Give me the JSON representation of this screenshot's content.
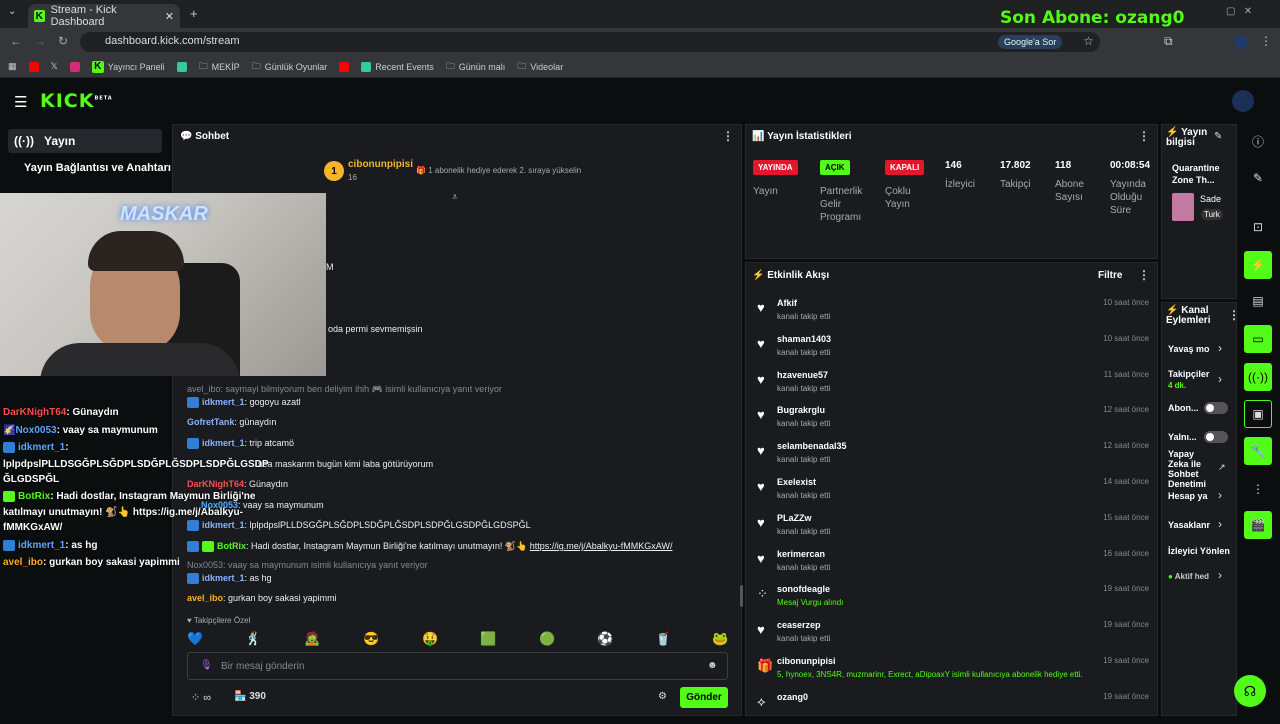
{
  "browser": {
    "tab_title": "Stream - Kick Dashboard",
    "url": "dashboard.kick.com/stream",
    "google_btn": "Google'a Sor",
    "bookmarks": [
      "Yayıncı Paneli",
      "MEKİP",
      "Günlük Oyunlar",
      "Recent Events",
      "Günün malı",
      "Videolar"
    ]
  },
  "overlay_top": "Son Abone: ozang0",
  "brand": {
    "logo": "KICK",
    "beta": "BETA"
  },
  "sidebar": {
    "items": [
      "Yayın",
      "Yayın Bağlantısı ve Anahtarı"
    ]
  },
  "webcam": {
    "label": "MASKAR"
  },
  "overlay_chat": [
    {
      "user": "DarKNighT64",
      "text": ": Günaydın"
    },
    {
      "user": "Nox0053",
      "text": ": vaay sa maymunum"
    },
    {
      "user": "idkmert_1",
      "text": ":"
    },
    {
      "user": "",
      "text": "lplpdpslPLLDSGĞPLSĞDPLSDĞPLĞSDPLSDPĞLGSDP"
    },
    {
      "user": "",
      "text": "ĞLGDSPĞL"
    },
    {
      "user": "BotRix",
      "text": ": Hadi dostlar, Instagram Maymun Birliği'ne"
    },
    {
      "user": "",
      "text": "katılmayı unutmayın! 🐒👆 https://ig.me/j/Abalkyu-"
    },
    {
      "user": "",
      "text": "fMMKGxAW/"
    },
    {
      "user": "idkmert_1",
      "text": ": as hg"
    },
    {
      "user": "avel_ibo",
      "text": ": gurkan boy sakasi yapimmi"
    }
  ],
  "chat": {
    "title": "Sohbet",
    "gifter": "cibonunpipisi",
    "gifter_count": "16",
    "gift_hint": "1 abonelik hediye ederek 2. sıraya yükselin",
    "partial1": "M",
    "partial2": "oda permi sevmemişsin",
    "messages": [
      {
        "reply": "avel_ibo: saymayi bilmiyorum ben deliyim ihih 🎮 isimli kullanıcıya yanıt veriyor"
      },
      {
        "user": "idkmert_1",
        "text": ": gogoyu azatl"
      },
      {
        "user": "GofretTank",
        "text": ": günaydın"
      },
      {
        "user": "idkmert_1",
        "text": ": trip atcamö"
      },
      {
        "user": "",
        "text": "sea maskarım bugün kimi laba götürüyorum"
      },
      {
        "user": "DarKNighT64",
        "text": ": Günaydın"
      },
      {
        "user": "Nox0053",
        "text": ": vaay sa maymunum"
      },
      {
        "user": "idkmert_1",
        "text": ": lplpdpslPLLDSGĞPLSĞDPLSDĞPLĞSDPLSDPĞLGSDPĞLGDSPĞL"
      },
      {
        "user": "BotRix",
        "text": ": Hadi dostlar, Instagram Maymun Birliği'ne katılmayı unutmayın! 🐒👆 ",
        "link": "https://ig.me/j/Abalkyu-fMMKGxAW/"
      },
      {
        "reply": "Nox0053: vaay sa maymunum isimli kullanıcıya yanıt veriyor"
      },
      {
        "user": "idkmert_1",
        "text": ": as hg"
      },
      {
        "user": "avel_ibo",
        "text": ": gurkan boy sakasi yapimmi"
      }
    ],
    "emote_label": "Takipçilere Özel",
    "input_placeholder": "Bir mesaj gönderin",
    "points": "390",
    "send": "Gönder"
  },
  "stats": {
    "title": "Yayın İstatistikleri",
    "items": [
      {
        "pill": "YAYINDA",
        "color": "#e5162b",
        "label": "Yayın"
      },
      {
        "pill": "AÇIK",
        "color": "#53fc18",
        "label": "Partnerlik Gelir Programı"
      },
      {
        "pill": "KAPALI",
        "color": "#e5162b",
        "label": "Çoklu Yayın"
      },
      {
        "value": "146",
        "label": "İzleyici"
      },
      {
        "value": "17.802",
        "label": "Takipçi"
      },
      {
        "value": "118",
        "label": "Abone Sayısı"
      },
      {
        "value": "00:08:54",
        "label": "Yayında Olduğu Süre"
      }
    ]
  },
  "activity": {
    "title": "Etkinlik Akışı",
    "filter": "Filtre",
    "events": [
      {
        "name": "Afkif",
        "sub": "kanalı takip etti",
        "time": "10 saat önce"
      },
      {
        "name": "shaman1403",
        "sub": "kanalı takip etti",
        "time": "10 saat önce"
      },
      {
        "name": "hzavenue57",
        "sub": "kanalı takip etti",
        "time": "11 saat önce"
      },
      {
        "name": "Bugrakrglu",
        "sub": "kanalı takip etti",
        "time": "12 saat önce"
      },
      {
        "name": "selambenadal35",
        "sub": "kanalı takip etti",
        "time": "12 saat önce"
      },
      {
        "name": "Exelexist",
        "sub": "kanalı takip etti",
        "time": "14 saat önce"
      },
      {
        "name": "PLaZZw",
        "sub": "kanalı takip etti",
        "time": "15 saat önce"
      },
      {
        "name": "kerimercan",
        "sub": "kanalı takip etti",
        "time": "16 saat önce"
      },
      {
        "name": "sonofdeagle",
        "sub": "Mesaj Vurgu alındı",
        "time": "19 saat önce"
      },
      {
        "name": "ceaserzep",
        "sub": "kanalı takip etti",
        "time": "19 saat önce"
      },
      {
        "name": "cibonunpipisi",
        "sub": "5, hynoex, 3NS4R, muzmarinr, Exrect, aDipoaxY isimli kullanıcıya abonelik hediye etti.",
        "time": "19 saat önce"
      },
      {
        "name": "ozang0",
        "sub": "",
        "time": "19 saat önce"
      }
    ]
  },
  "stream_info": {
    "title": "Yayın bilgisi",
    "game": "Quarantine Zone Th...",
    "tag1": "Sade",
    "tag2": "Turk"
  },
  "channel_actions": {
    "title": "Kanal Eylemleri",
    "items": [
      "Yavaş mo",
      "Takipçiler",
      "Abon...",
      "Yalnı...",
      "Yapay Zeka ile Sohbet Denetimi",
      "Hesap ya",
      "Yasaklanr",
      "İzleyici Yönlen",
      "Aktif hed"
    ],
    "followers_sub": "4 dk."
  }
}
